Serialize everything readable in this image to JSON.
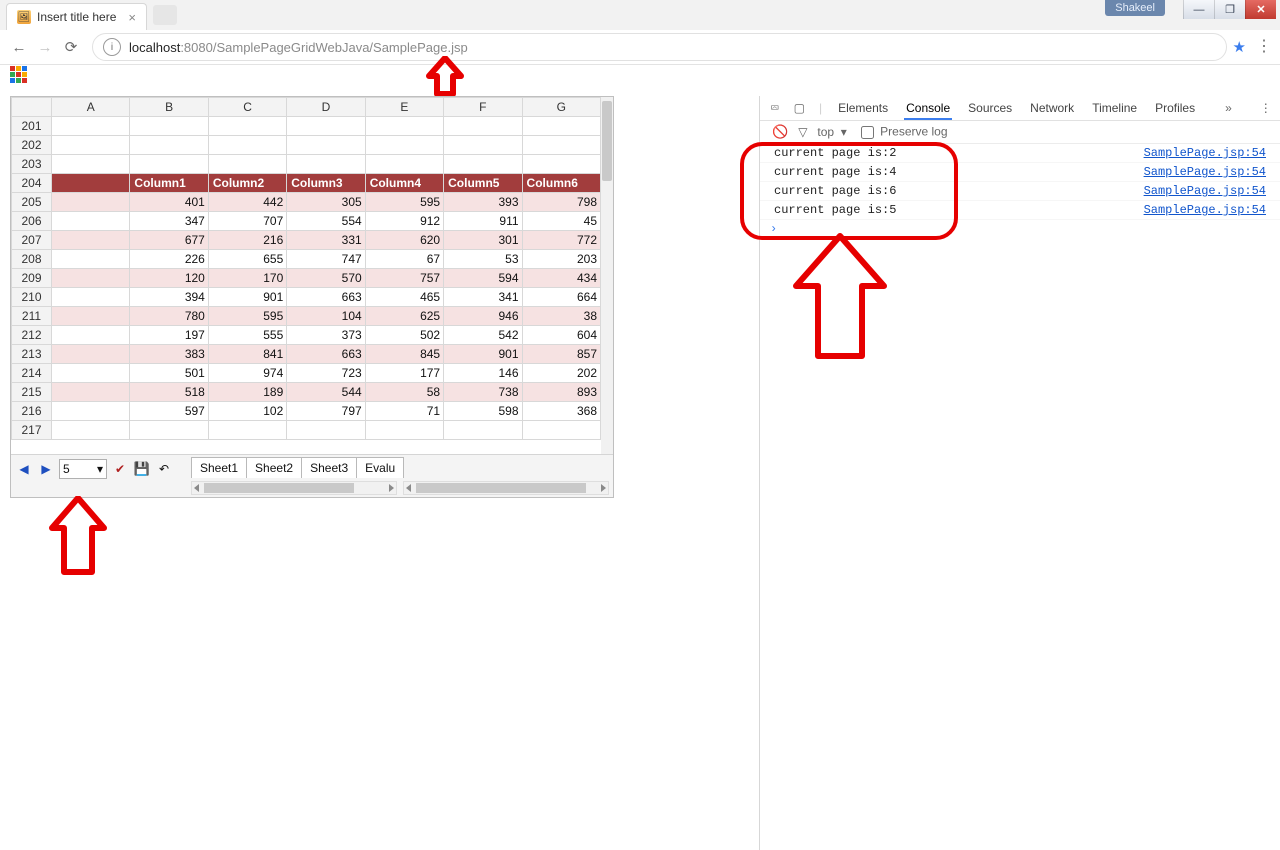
{
  "browser": {
    "user": "Shakeel",
    "tab_title": "Insert title here",
    "url_host": "localhost",
    "url_port": ":8080",
    "url_path": "/SamplePageGridWebJava/SamplePage.jsp"
  },
  "grid": {
    "columns": [
      "A",
      "B",
      "C",
      "D",
      "E",
      "F",
      "G"
    ],
    "row_start": 201,
    "row_end": 217,
    "header_row_index": 204,
    "column_headers": [
      "Column1",
      "Column2",
      "Column3",
      "Column4",
      "Column5",
      "Column6"
    ],
    "data_start_row": 205,
    "data_end_row": 216,
    "data": [
      [
        401,
        442,
        305,
        595,
        393,
        798
      ],
      [
        347,
        707,
        554,
        912,
        911,
        45
      ],
      [
        677,
        216,
        331,
        620,
        301,
        772
      ],
      [
        226,
        655,
        747,
        67,
        53,
        203
      ],
      [
        120,
        170,
        570,
        757,
        594,
        434
      ],
      [
        394,
        901,
        663,
        465,
        341,
        664
      ],
      [
        780,
        595,
        104,
        625,
        946,
        38
      ],
      [
        197,
        555,
        373,
        502,
        542,
        604
      ],
      [
        383,
        841,
        663,
        845,
        901,
        857
      ],
      [
        501,
        974,
        723,
        177,
        146,
        202
      ],
      [
        518,
        189,
        544,
        58,
        738,
        893
      ],
      [
        597,
        102,
        797,
        71,
        598,
        368
      ]
    ],
    "page_value": "5",
    "sheet_tabs": [
      "Sheet1",
      "Sheet2",
      "Sheet3",
      "Evalu"
    ]
  },
  "devtools": {
    "tabs": [
      "Elements",
      "Console",
      "Sources",
      "Network",
      "Timeline",
      "Profiles"
    ],
    "active_tab": "Console",
    "subbar": {
      "scope": "top",
      "preserve_label": "Preserve log"
    },
    "log": [
      {
        "msg": "current page is:2",
        "src": "SamplePage.jsp:54"
      },
      {
        "msg": "current page is:4",
        "src": "SamplePage.jsp:54"
      },
      {
        "msg": "current page is:6",
        "src": "SamplePage.jsp:54"
      },
      {
        "msg": "current page is:5",
        "src": "SamplePage.jsp:54"
      }
    ]
  }
}
